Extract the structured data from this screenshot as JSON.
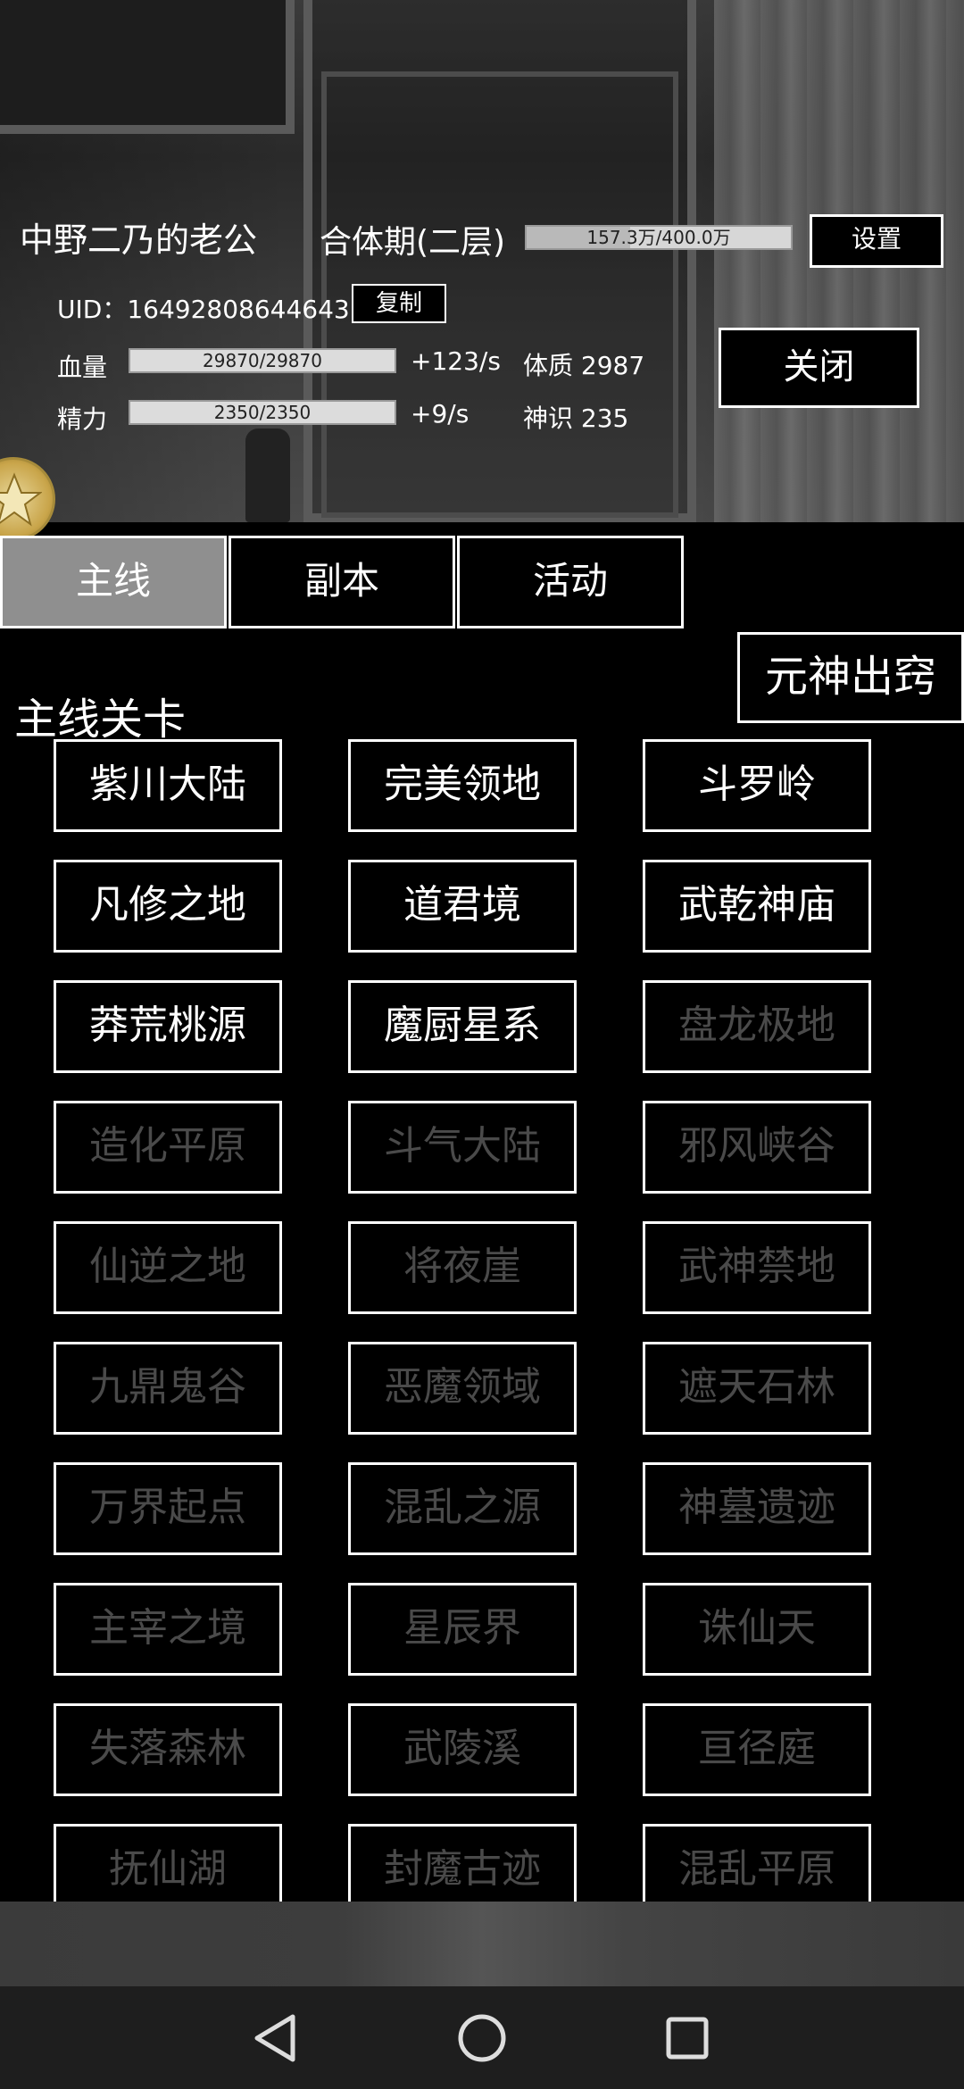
{
  "player": {
    "name": "中野二乃的老公",
    "realm": "合体期(二层)",
    "exp_text": "157.3万/400.0万",
    "exp_fraction": 0.393,
    "uid_label": "UID：16492808644643",
    "hp_label": "血量",
    "hp_text": "29870/29870",
    "hp_fraction": 1.0,
    "hp_regen": "+123/s",
    "constitution": "体质 2987",
    "mp_label": "精力",
    "mp_text": "2350/2350",
    "mp_fraction": 1.0,
    "mp_regen": "+9/s",
    "divine_sense": "神识 235"
  },
  "buttons": {
    "copy": "复制",
    "settings": "设置",
    "close": "关闭",
    "soul": "元神出窍"
  },
  "tabs": [
    {
      "label": "主线",
      "active": true
    },
    {
      "label": "副本",
      "active": false
    },
    {
      "label": "活动",
      "active": false
    }
  ],
  "section_title": "主线关卡",
  "stages": [
    {
      "name": "紫川大陆",
      "unlocked": true
    },
    {
      "name": "完美领地",
      "unlocked": true
    },
    {
      "name": "斗罗岭",
      "unlocked": true
    },
    {
      "name": "凡修之地",
      "unlocked": true
    },
    {
      "name": "道君境",
      "unlocked": true
    },
    {
      "name": "武乾神庙",
      "unlocked": true
    },
    {
      "name": "莽荒桃源",
      "unlocked": true
    },
    {
      "name": "魔厨星系",
      "unlocked": true
    },
    {
      "name": "盘龙极地",
      "unlocked": false
    },
    {
      "name": "造化平原",
      "unlocked": false
    },
    {
      "name": "斗气大陆",
      "unlocked": false
    },
    {
      "name": "邪风峡谷",
      "unlocked": false
    },
    {
      "name": "仙逆之地",
      "unlocked": false
    },
    {
      "name": "将夜崖",
      "unlocked": false
    },
    {
      "name": "武神禁地",
      "unlocked": false
    },
    {
      "name": "九鼎鬼谷",
      "unlocked": false
    },
    {
      "name": "恶魔领域",
      "unlocked": false
    },
    {
      "name": "遮天石林",
      "unlocked": false
    },
    {
      "name": "万界起点",
      "unlocked": false
    },
    {
      "name": "混乱之源",
      "unlocked": false
    },
    {
      "name": "神墓遗迹",
      "unlocked": false
    },
    {
      "name": "主宰之境",
      "unlocked": false
    },
    {
      "name": "星辰界",
      "unlocked": false
    },
    {
      "name": "诛仙天",
      "unlocked": false
    },
    {
      "name": "失落森林",
      "unlocked": false
    },
    {
      "name": "武陵溪",
      "unlocked": false
    },
    {
      "name": "亘径庭",
      "unlocked": false
    },
    {
      "name": "抚仙湖",
      "unlocked": false
    },
    {
      "name": "封魔古迹",
      "unlocked": false
    },
    {
      "name": "混乱平原",
      "unlocked": false
    }
  ],
  "icons": {
    "badge": "star-icon",
    "nav_back": "triangle-back-icon",
    "nav_home": "circle-home-icon",
    "nav_recent": "square-recent-icon"
  },
  "colors": {
    "unlocked_text": "#ffffff",
    "locked_text": "#4a4a4a",
    "active_tab": "#8f8f8f",
    "badge_gold": "#c9a54a"
  }
}
